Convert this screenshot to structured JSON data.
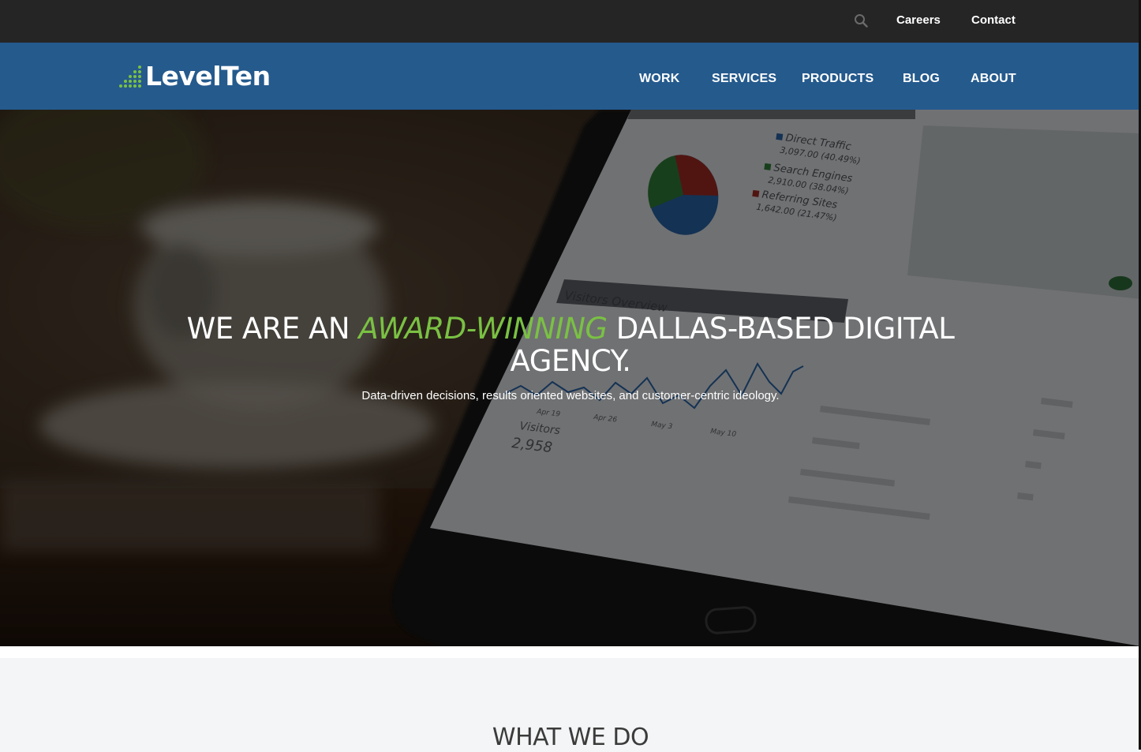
{
  "top_bar": {
    "search_icon": "search-icon",
    "links": [
      "Careers",
      "Contact"
    ]
  },
  "nav": {
    "logo_text": "LevelTen",
    "items": [
      "WORK",
      "SERVICES",
      "PRODUCTS",
      "BLOG",
      "ABOUT"
    ]
  },
  "hero": {
    "title_before": "WE ARE AN ",
    "title_accent": "AWARD-WINNING",
    "title_after": " DALLAS-BASED DIGITAL AGENCY.",
    "subtitle": "Data-driven decisions, results oriented websites, and customer-centric ideology.",
    "image": {
      "legend": [
        {
          "label": "Direct Traffic",
          "value": "3,097.00 (40.49%)"
        },
        {
          "label": "Search Engines",
          "value": "2,910.00 (38.04%)"
        },
        {
          "label": "Referring Sites",
          "value": "1,642.00 (21.47%)"
        }
      ],
      "panel_title": "Visitors Overview",
      "visitors_label": "Visitors",
      "visitors_value": "2,958",
      "date_labels": [
        "Apr 19",
        "Apr 26",
        "May 3",
        "May 10"
      ]
    }
  },
  "what_we_do": {
    "title": "WHAT WE DO"
  },
  "colors": {
    "top_bar": "#252525",
    "nav": "#255a8d",
    "accent": "#7ac143",
    "section_bg": "#f4f5f6"
  }
}
